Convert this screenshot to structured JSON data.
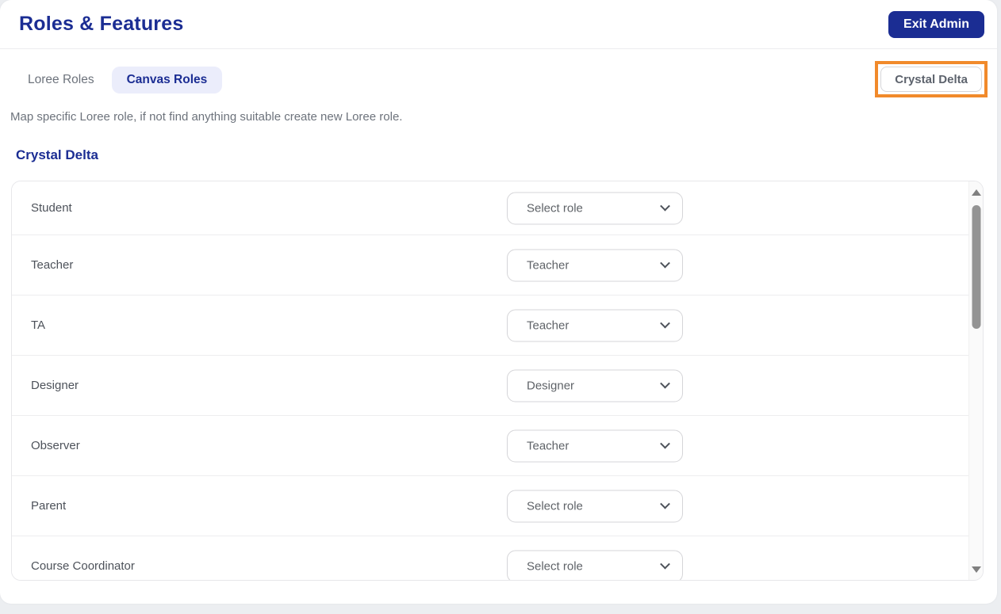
{
  "page": {
    "title": "Roles & Features"
  },
  "header": {
    "exit_admin_label": "Exit Admin"
  },
  "tabs": [
    {
      "label": "Loree Roles",
      "active": false
    },
    {
      "label": "Canvas Roles",
      "active": true
    }
  ],
  "lms_button": {
    "label": "Crystal Delta"
  },
  "description": "Map specific Loree role, if not find anything suitable create new Loree role.",
  "section_heading": "Crystal Delta",
  "role_mappings": [
    {
      "canvas_role": "Student",
      "selected": "Select role"
    },
    {
      "canvas_role": "Teacher",
      "selected": "Teacher"
    },
    {
      "canvas_role": "TA",
      "selected": "Teacher"
    },
    {
      "canvas_role": "Designer",
      "selected": "Designer"
    },
    {
      "canvas_role": "Observer",
      "selected": "Teacher"
    },
    {
      "canvas_role": "Parent",
      "selected": "Select role"
    },
    {
      "canvas_role": "Course Coordinator",
      "selected": "Select role"
    }
  ],
  "icons": {
    "select_chevron": "chevron-down-icon",
    "scroll_up": "scroll-up-arrow-icon",
    "scroll_down": "scroll-down-arrow-icon"
  },
  "colors": {
    "brand-navy": "#1b2d93",
    "tab-active-bg": "#ebedfb",
    "highlight-orange": "#f18a2b",
    "text-gray": "#6d737c",
    "label-gray": "#4d525a",
    "border-gray": "#e7e7ea",
    "page-bg": "#eceef1",
    "scroll-thumb": "#949494"
  }
}
